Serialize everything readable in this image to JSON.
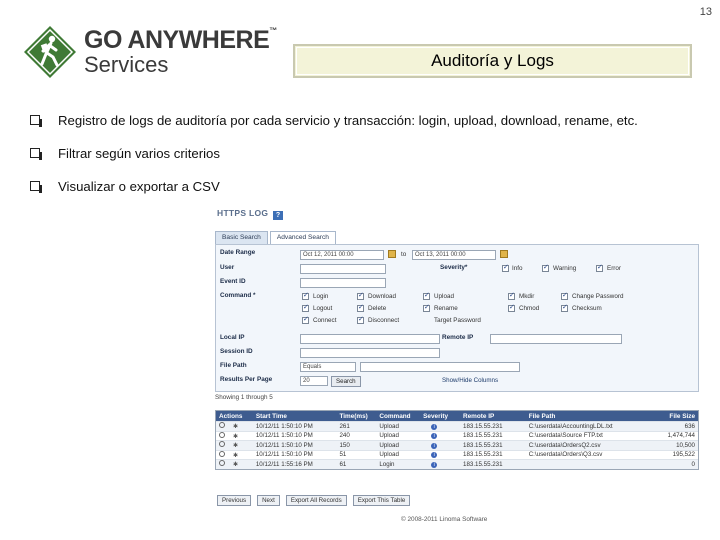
{
  "slide": {
    "number": "13",
    "title": "Auditoría y Logs"
  },
  "logo": {
    "line1": "GO ANYWHERE",
    "tm": "™",
    "line2": "Services",
    "brand_color": "#3f7a35"
  },
  "bullets": [
    "Registro de logs de auditoría por cada servicio y transacción: login, upload, download, rename, etc.",
    "Filtrar según varios criterios",
    "Visualizar o exportar a CSV"
  ],
  "app": {
    "title": "HTTPS LOG",
    "help": "?",
    "tabs": [
      "Basic Search",
      "Advanced Search"
    ],
    "fields": {
      "date_range_label": "Date Range",
      "date_from": "Oct 12, 2011 00:00",
      "to_label": "to",
      "date_to": "Oct 13, 2011 00:00",
      "user_label": "User",
      "event_id_label": "Event ID",
      "severity_label": "Severity*",
      "severity_options": [
        "Info",
        "Warning",
        "Error"
      ],
      "command_label": "Command *",
      "commands": [
        "Login",
        "Download",
        "Upload",
        "Mkdir",
        "Change Password",
        "Logout",
        "Delete",
        "Rename",
        "Chmod",
        "Checksum",
        "Connect",
        "Disconnect",
        "Target Password"
      ],
      "local_ip_label": "Local IP",
      "remote_ip_label": "Remote IP",
      "session_id_label": "Session ID",
      "file_path_label": "File Path",
      "file_path_op": "Equals",
      "results_label": "Results Per Page",
      "results_value": "20",
      "search_button": "Search",
      "show_hide": "Show/Hide Columns"
    },
    "showing": "Showing 1 through 5",
    "table": {
      "headers": [
        "Actions",
        "Start Time",
        "Time(ms)",
        "Command",
        "Severity",
        "Remote IP",
        "File Path",
        "File Size"
      ],
      "rows": [
        [
          "10/12/11 1:50:10 PM",
          "261",
          "Upload",
          "i",
          "183.15.55.231",
          "C:\\userdata\\AccountingLDL.txt",
          "636"
        ],
        [
          "10/12/11 1:50:10 PM",
          "240",
          "Upload",
          "i",
          "183.15.55.231",
          "C:\\userdata\\Source FTP.txt",
          "1,474,744"
        ],
        [
          "10/12/11 1:50:10 PM",
          "150",
          "Upload",
          "i",
          "183.15.55.231",
          "C:\\userdata\\OrdersQ2.csv",
          "10,500"
        ],
        [
          "10/12/11 1:50:10 PM",
          "51",
          "Upload",
          "i",
          "183.15.55.231",
          "C:\\userdata\\Orders\\Q3.csv",
          "195,522"
        ],
        [
          "10/12/11 1:55:16 PM",
          "61",
          "Login",
          "i",
          "183.15.55.231",
          "",
          "0"
        ]
      ]
    },
    "bottom_buttons": [
      "Previous",
      "Next",
      "Export All Records",
      "Export This Table"
    ],
    "copyright": "© 2008-2011 Linoma Software"
  }
}
